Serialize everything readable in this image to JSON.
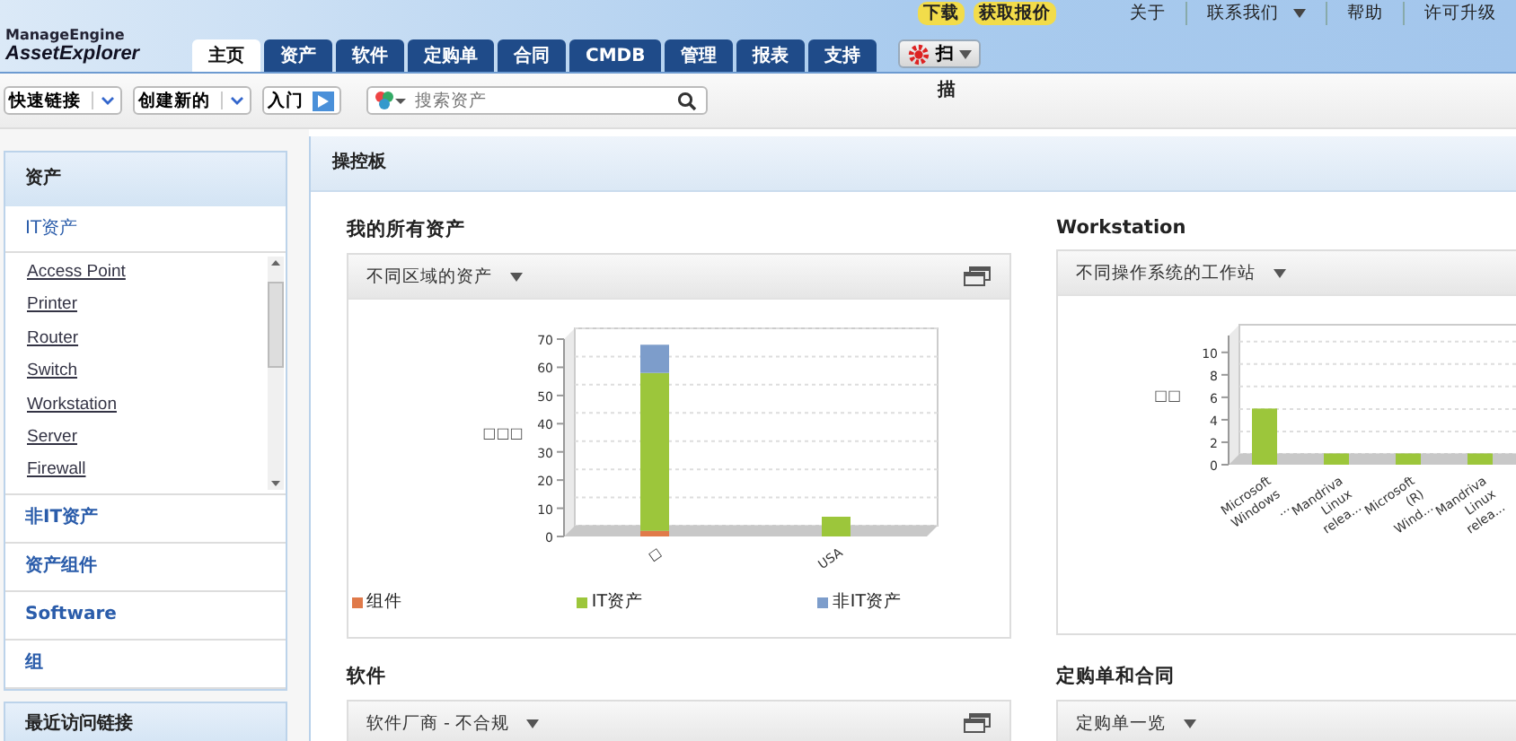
{
  "header": {
    "logo_top": "ManageEngine",
    "logo_main": "AssetExplorer",
    "tabs": [
      {
        "label": "主页",
        "selected": true
      },
      {
        "label": "资产",
        "selected": false
      },
      {
        "label": "软件",
        "selected": false
      },
      {
        "label": "定购单",
        "selected": false
      },
      {
        "label": "合同",
        "selected": false
      },
      {
        "label": "CMDB",
        "selected": false
      },
      {
        "label": "管理",
        "selected": false
      },
      {
        "label": "报表",
        "selected": false
      },
      {
        "label": "支持",
        "selected": false
      }
    ],
    "scan_button": {
      "label": "扫",
      "overflow": "描"
    },
    "badges": [
      "下载",
      "获取报价"
    ],
    "links": [
      {
        "label": "关于",
        "dropdown": false
      },
      {
        "label": "联系我们",
        "dropdown": true
      },
      {
        "label": "帮助",
        "dropdown": false
      },
      {
        "label": "许可升级",
        "dropdown": false
      }
    ]
  },
  "toolbar": {
    "menus": [
      "快速链接",
      "创建新的"
    ],
    "start": "入门",
    "search": {
      "placeholder": "搜索资产"
    }
  },
  "sidebar": {
    "title": "资产",
    "section": "IT资产",
    "types": [
      "Access Point",
      "Printer",
      "Router",
      "Switch",
      "Workstation",
      "Server",
      "Firewall"
    ],
    "items": [
      "非IT资产",
      "资产组件",
      "Software",
      "组"
    ],
    "recent_title": "最近访问链接"
  },
  "dashboard": {
    "title": "操控板",
    "widgets": [
      {
        "title": "我的所有资产",
        "view": "不同区域的资产",
        "restore": true,
        "chart_data": {
          "type": "bar",
          "ylabel": "□□□",
          "categories": [
            "□",
            "USA"
          ],
          "stacked": true,
          "ylim": [
            0,
            70
          ],
          "yticks": [
            0,
            10,
            20,
            30,
            40,
            50,
            60,
            70
          ],
          "series": [
            {
              "name": "组件",
              "color": "#e07a4a",
              "values": [
                2,
                0
              ]
            },
            {
              "name": "IT资产",
              "color": "#9cc63b",
              "values": [
                56,
                7
              ]
            },
            {
              "name": "非IT资产",
              "color": "#7d9dcb",
              "values": [
                10,
                0
              ]
            }
          ]
        }
      },
      {
        "title": "Workstation",
        "view": "不同操作系统的工作站",
        "restore": false,
        "chart_data": {
          "type": "bar",
          "ylabel": "□□",
          "categories": [
            "Microsoft Windows ...",
            "Mandriva Linux relea...",
            "Microsoft (R) Wind...",
            "Mandriva Linux relea..."
          ],
          "stacked": false,
          "ylim": [
            0,
            11.5
          ],
          "yticks": [
            0,
            2,
            4,
            6,
            8,
            10
          ],
          "series": [
            {
              "color": "#9cc63b",
              "values": [
                5,
                1,
                1,
                1
              ]
            }
          ]
        }
      }
    ],
    "lower": [
      {
        "title": "软件",
        "view": "软件厂商 - 不合规",
        "restore": true
      },
      {
        "title": "定购单和合同",
        "view": "定购单一览",
        "restore": false
      }
    ]
  }
}
